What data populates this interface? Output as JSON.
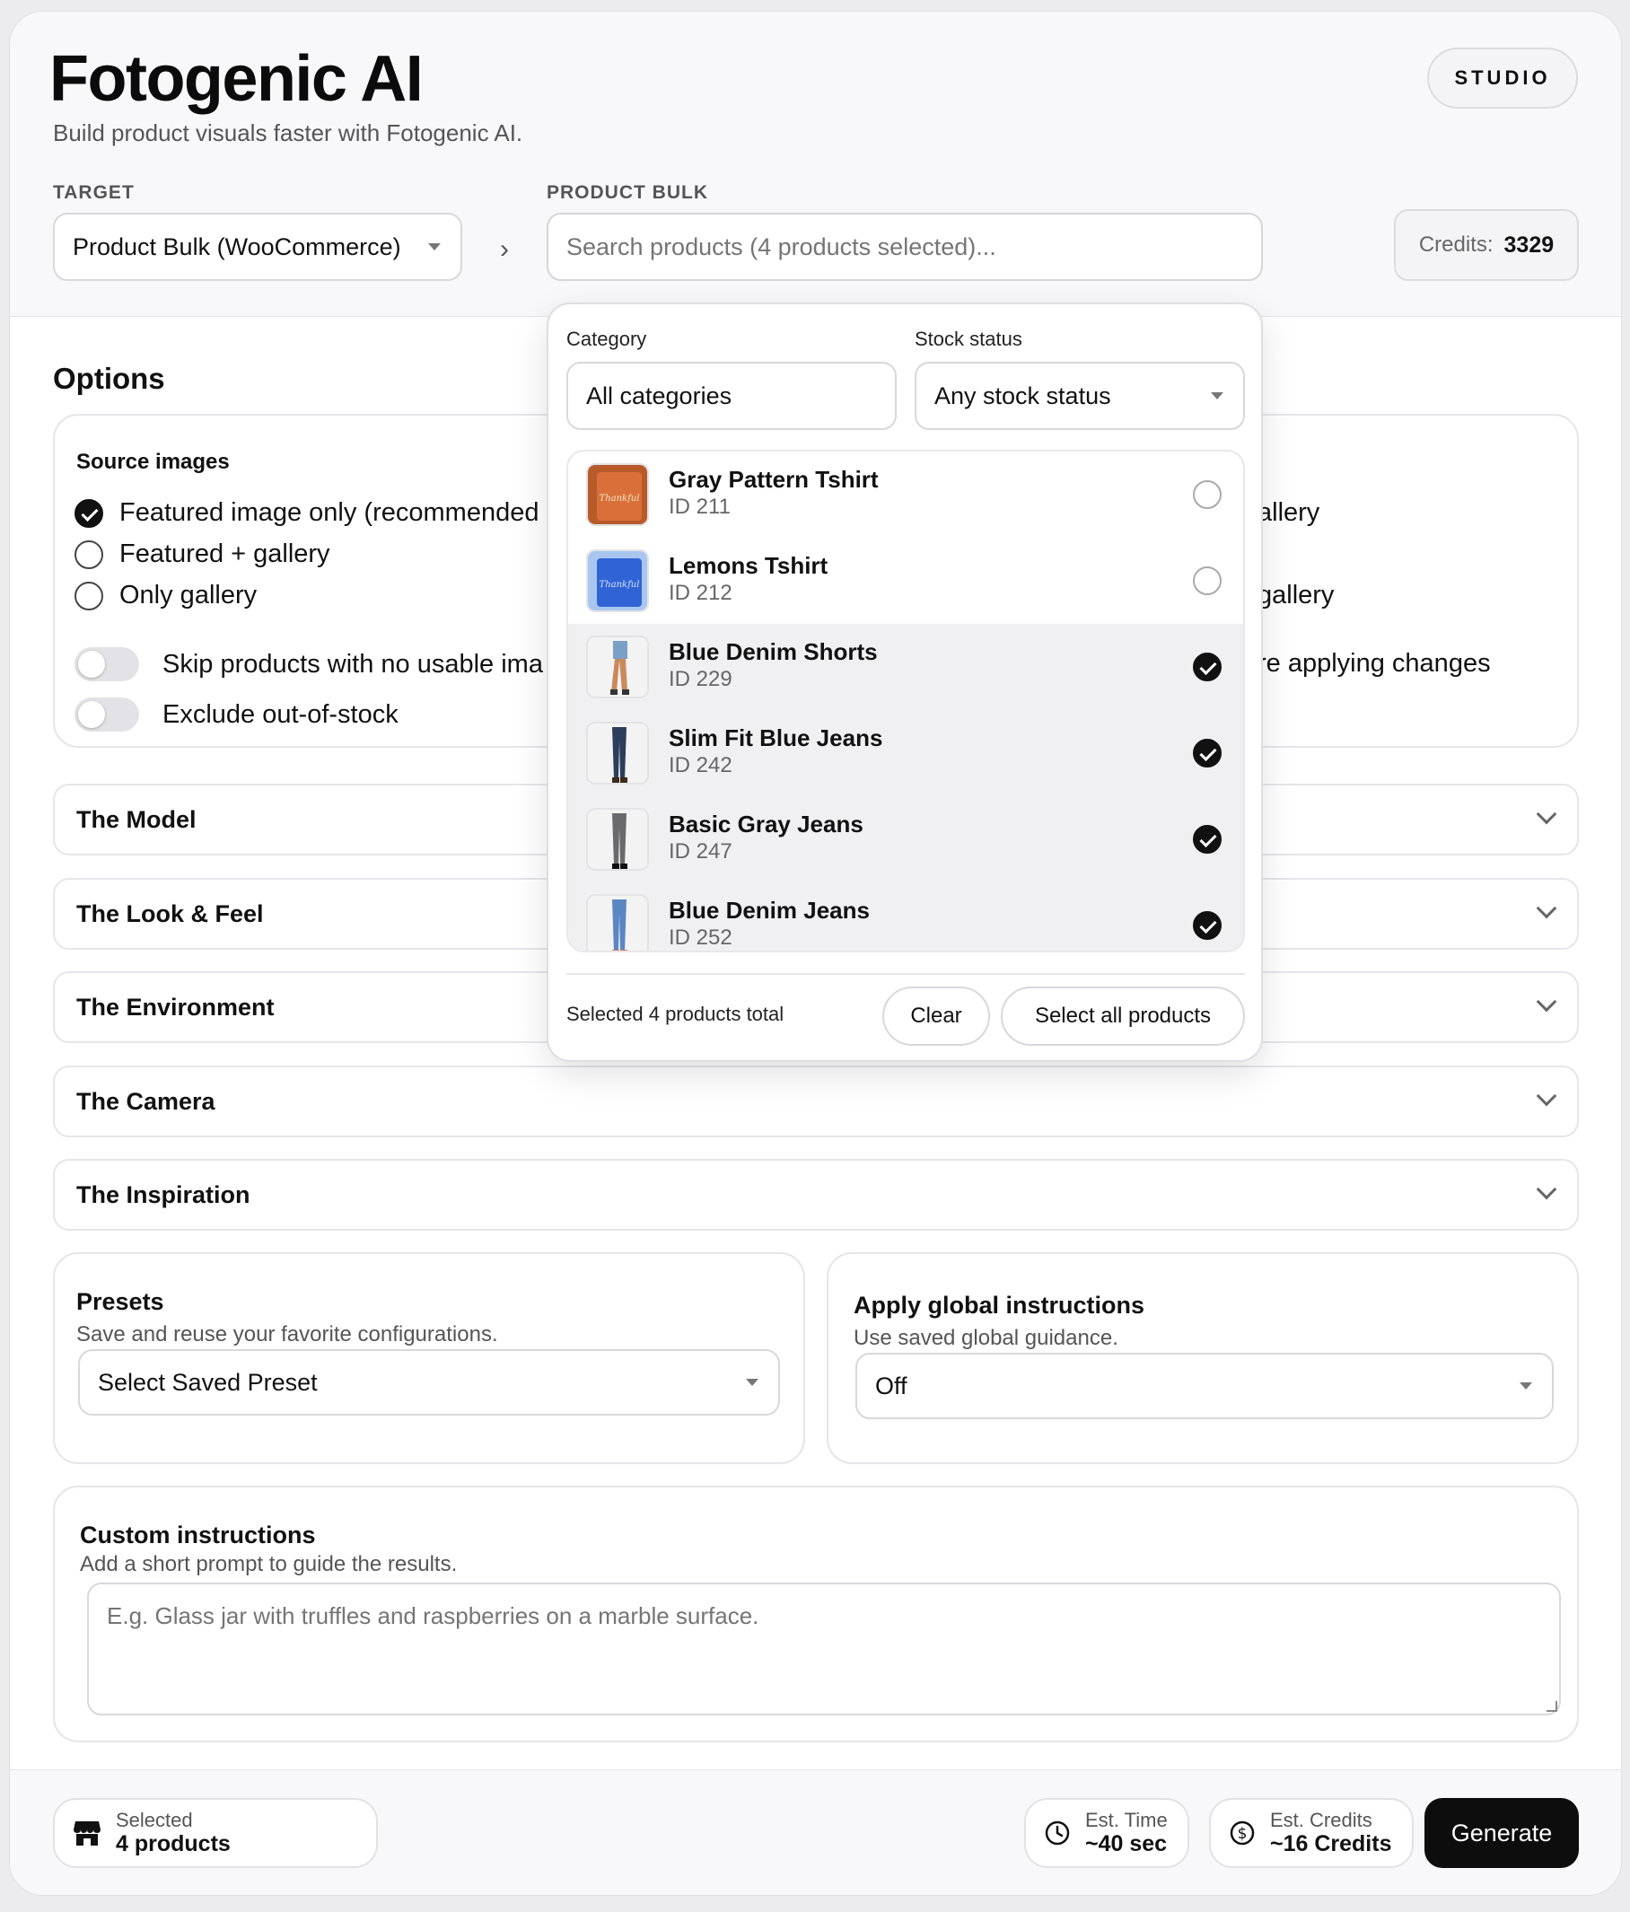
{
  "app": {
    "title": "Fotogenic AI",
    "tagline": "Build product visuals faster with Fotogenic AI.",
    "mode_badge": "STUDIO"
  },
  "header": {
    "target_label": "TARGET",
    "target_value": "Product Bulk (WooCommerce)",
    "product_bulk_label": "PRODUCT BULK",
    "search_placeholder": "Search products (4 products selected)...",
    "credits_label": "Credits:",
    "credits_value": "3329"
  },
  "picker": {
    "category_label": "Category",
    "category_value": "All categories",
    "stock_label": "Stock status",
    "stock_value": "Any stock status",
    "products": [
      {
        "name": "Gray Pattern Tshirt",
        "id": "ID 211",
        "selected": false,
        "thumb": "orange-tshirt"
      },
      {
        "name": "Lemons Tshirt",
        "id": "ID 212",
        "selected": false,
        "thumb": "blue-tshirt"
      },
      {
        "name": "Blue Denim Shorts",
        "id": "ID 229",
        "selected": true,
        "thumb": "model-shorts"
      },
      {
        "name": "Slim Fit Blue Jeans",
        "id": "ID 242",
        "selected": true,
        "thumb": "model-jeans-dark"
      },
      {
        "name": "Basic Gray Jeans",
        "id": "ID 247",
        "selected": true,
        "thumb": "model-jeans-gray"
      },
      {
        "name": "Blue Denim Jeans",
        "id": "ID 252",
        "selected": true,
        "thumb": "model-jeans-light"
      }
    ],
    "total_text": "Selected 4 products total",
    "clear_label": "Clear",
    "select_all_label": "Select all products"
  },
  "options": {
    "title": "Options",
    "source_title": "Source images",
    "source_options": [
      {
        "label": "Featured image only (recommended",
        "selected": true
      },
      {
        "label": "Featured + gallery",
        "selected": false
      },
      {
        "label": "Only gallery",
        "selected": false
      }
    ],
    "toggles": [
      {
        "label": "Skip products with no usable ima",
        "on": false
      },
      {
        "label": "Exclude out-of-stock",
        "on": false
      }
    ],
    "right_fragments": [
      "allery",
      "gallery",
      "re applying changes"
    ]
  },
  "accordions": [
    "The Model",
    "The Look & Feel",
    "The Environment",
    "The Camera",
    "The Inspiration"
  ],
  "presets": {
    "title": "Presets",
    "subtitle": "Save and reuse your favorite configurations.",
    "value": "Select Saved Preset"
  },
  "global": {
    "title": "Apply global instructions",
    "subtitle": "Use saved global guidance.",
    "value": "Off"
  },
  "custom": {
    "title": "Custom instructions",
    "subtitle": "Add a short prompt to guide the results.",
    "placeholder": "E.g. Glass jar with truffles and raspberries on a marble surface."
  },
  "footer": {
    "selected_label": "Selected",
    "selected_value": "4 products",
    "time_label": "Est. Time",
    "time_value": "~40 sec",
    "credits_label": "Est. Credits",
    "credits_value": "~16 Credits",
    "generate_label": "Generate",
    "icons": [
      "store-icon",
      "clock-icon",
      "dollar-icon"
    ]
  },
  "colors": {
    "accent": "#0d0d0d",
    "background": "#ececef",
    "header_bg": "#f8f8fa"
  }
}
